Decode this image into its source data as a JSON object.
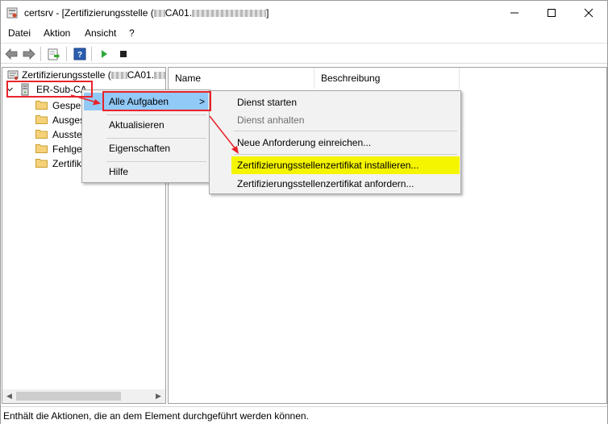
{
  "window": {
    "title_prefix": "certsrv - [Zertifizierungsstelle (",
    "title_mid": "CA01.",
    "title_suffix": "]",
    "minimize_icon": "minimize-icon",
    "maximize_icon": "maximize-icon",
    "close_icon": "close-icon"
  },
  "menubar": {
    "items": [
      "Datei",
      "Aktion",
      "Ansicht",
      "?"
    ]
  },
  "toolbar": {
    "icons": [
      "back-arrow-icon",
      "forward-arrow-icon",
      "export-list-icon",
      "help-icon",
      "start-service-icon",
      "stop-service-icon"
    ]
  },
  "tree": {
    "root_label_prefix": "Zertifizierungsstelle (",
    "root_label_mid": "CA01.",
    "ca_label": "ER-Sub-CA",
    "children": [
      "Gesper",
      "Ausges",
      "Ausste",
      "Fehlge",
      "Zertifik"
    ]
  },
  "list": {
    "columns": [
      "Name",
      "Beschreibung"
    ]
  },
  "context_menu": {
    "items": [
      "Alle Aufgaben",
      "Aktualisieren",
      "Eigenschaften",
      "Hilfe"
    ],
    "submenu_arrow": ">"
  },
  "submenu": {
    "items": [
      {
        "label": "Dienst starten",
        "enabled": true
      },
      {
        "label": "Dienst anhalten",
        "enabled": false
      },
      {
        "label": "Neue Anforderung einreichen...",
        "enabled": true
      },
      {
        "label": "Zertifizierungsstellenzertifikat installieren...",
        "enabled": true,
        "highlighted": true
      },
      {
        "label": "Zertifizierungsstellenzertifikat anfordern...",
        "enabled": true
      }
    ]
  },
  "statusbar": {
    "text": "Enthält die Aktionen, die an dem Element durchgeführt werden können."
  },
  "colors": {
    "highlight_yellow": "#f5f500",
    "annotation_red": "#e8232a",
    "menu_hover_blue": "#91c9f7",
    "disabled_text": "#6d6d6d"
  }
}
